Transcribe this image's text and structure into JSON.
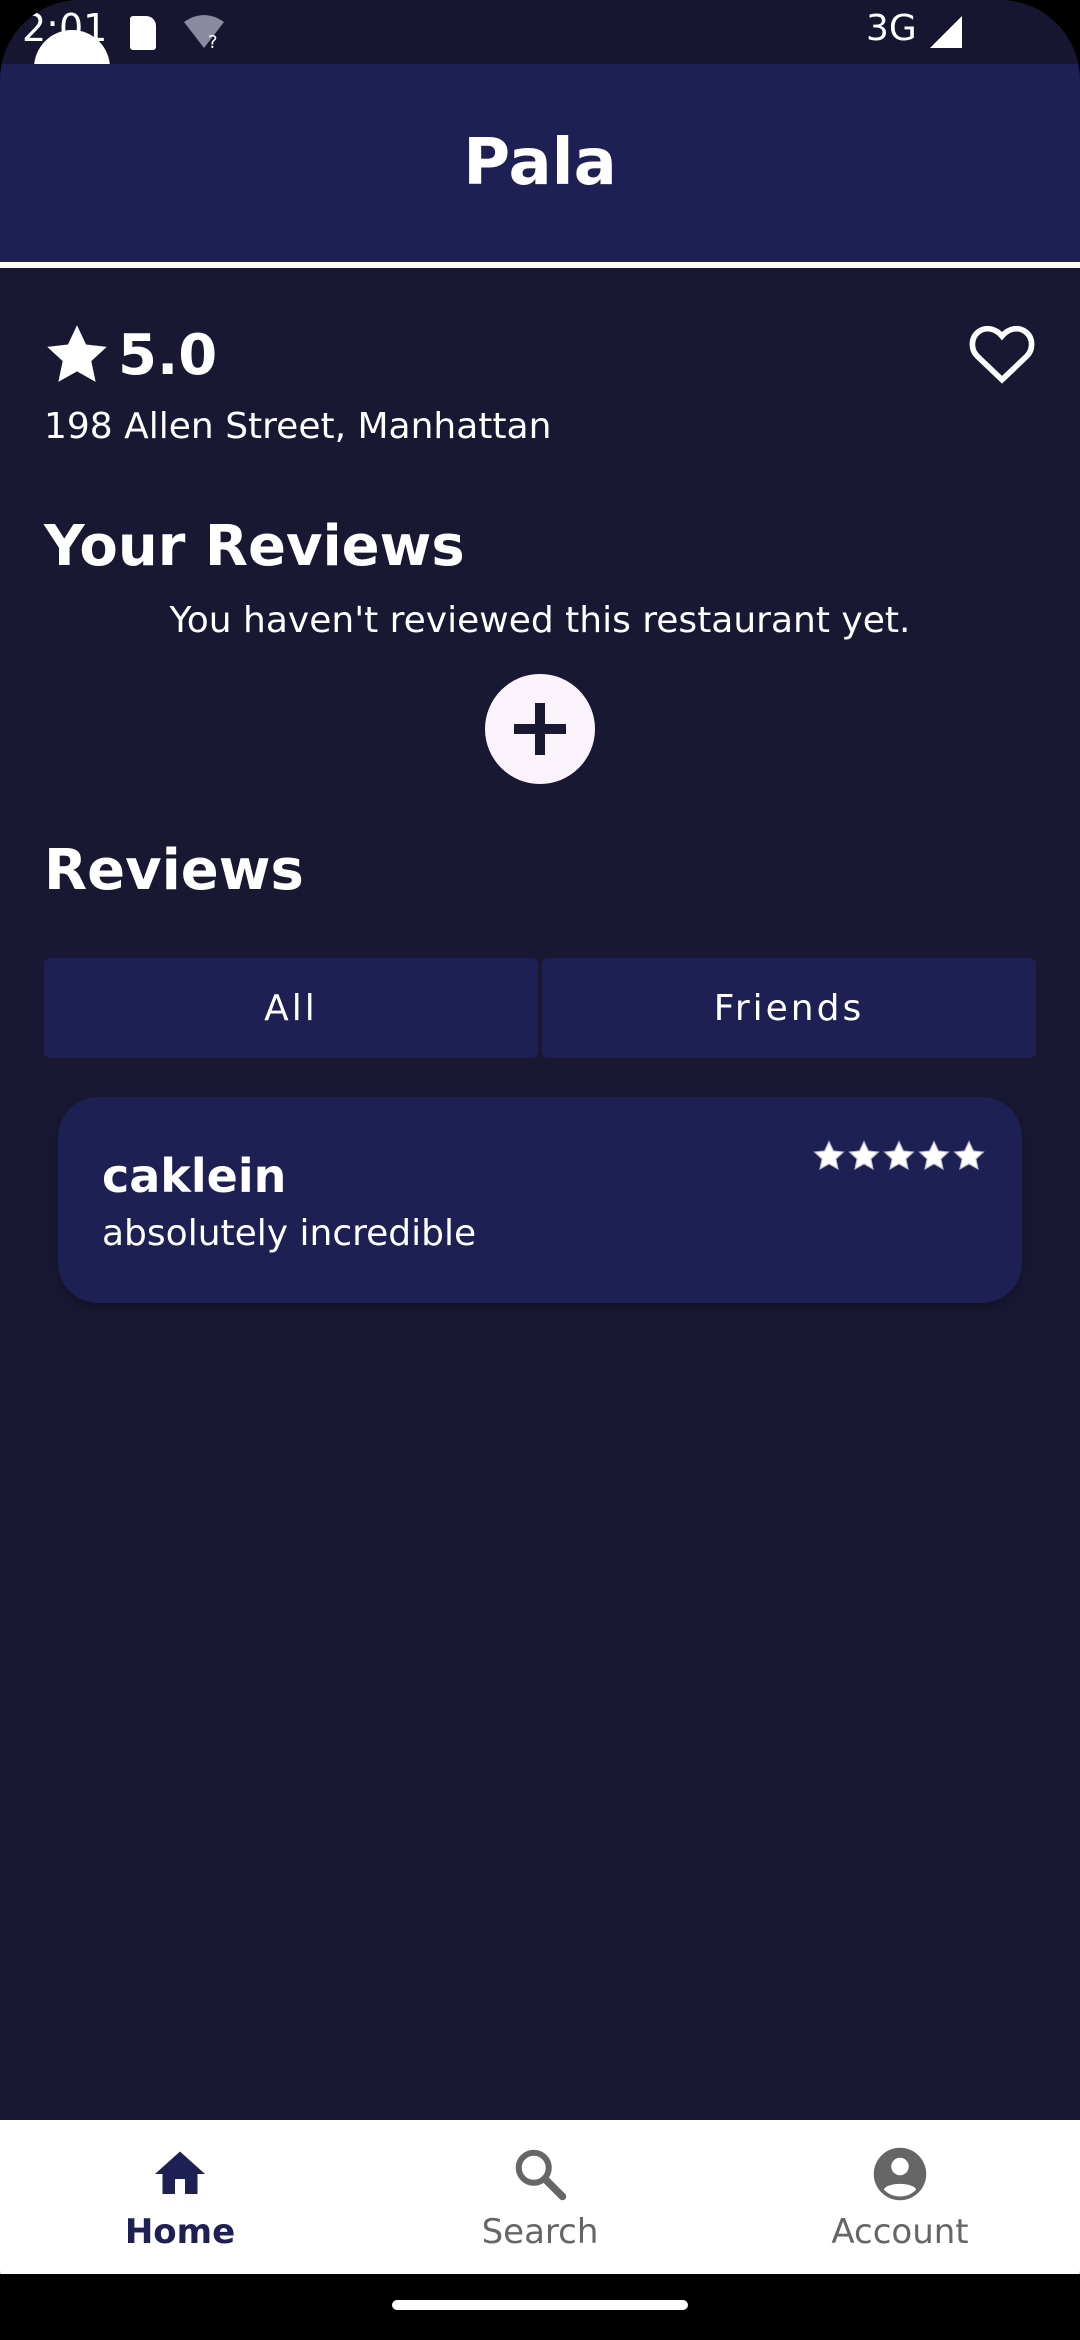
{
  "status_bar": {
    "time": "2:01",
    "network": "3G"
  },
  "app_bar": {
    "title": "Pala"
  },
  "restaurant": {
    "rating": "5.0",
    "address": "198 Allen Street, Manhattan"
  },
  "your_reviews": {
    "title": "Your Reviews",
    "empty_message": "You haven't reviewed this restaurant yet."
  },
  "reviews": {
    "title": "Reviews",
    "tabs": [
      {
        "label": "All"
      },
      {
        "label": "Friends"
      }
    ],
    "items": [
      {
        "user": "caklein",
        "text": "absolutely incredible",
        "stars": 5
      }
    ]
  },
  "bottom_nav": {
    "items": [
      {
        "label": "Home",
        "icon": "home-icon",
        "active": true
      },
      {
        "label": "Search",
        "icon": "search-icon",
        "active": false
      },
      {
        "label": "Account",
        "icon": "account-icon",
        "active": false
      }
    ]
  },
  "colors": {
    "background": "#181833",
    "app_bar": "#1e1f52",
    "card": "#1e1f52",
    "accent_text": "#ffffff",
    "nav_active": "#1e1f52"
  }
}
